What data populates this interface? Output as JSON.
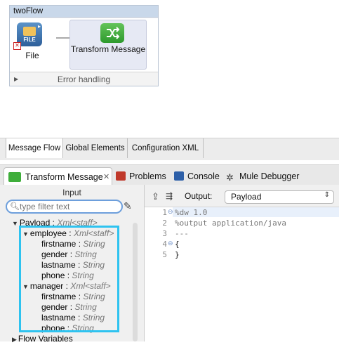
{
  "flow": {
    "title": "twoFlow",
    "file_label": "File",
    "file_icon_text": "FILE",
    "transform_label": "Transform Message",
    "error_handling": "Error handling"
  },
  "editor_tabs": [
    "Message Flow",
    "Global Elements",
    "Configuration XML"
  ],
  "view_tabs": {
    "active": "Transform Message",
    "others": [
      "Problems",
      "Console",
      "Mule Debugger"
    ]
  },
  "input": {
    "title": "Input",
    "filter_placeholder": "type filter text",
    "tree": {
      "payload": {
        "name": "Payload",
        "type": "Xml<staff>"
      },
      "employee": {
        "name": "employee",
        "type": "Xml<staff>",
        "fields": [
          {
            "name": "firstname",
            "type": "String"
          },
          {
            "name": "gender",
            "type": "String"
          },
          {
            "name": "lastname",
            "type": "String"
          },
          {
            "name": "phone",
            "type": "String"
          }
        ]
      },
      "manager": {
        "name": "manager",
        "type": "Xml<staff>",
        "fields": [
          {
            "name": "firstname",
            "type": "String"
          },
          {
            "name": "gender",
            "type": "String"
          },
          {
            "name": "lastname",
            "type": "String"
          },
          {
            "name": "phone",
            "type": "String"
          }
        ]
      },
      "flow_variables": "Flow Variables"
    }
  },
  "output": {
    "label": "Output:",
    "selected": "Payload",
    "lines": [
      {
        "n": "1",
        "text": "%dw 1.0"
      },
      {
        "n": "2",
        "text": "%output application/java"
      },
      {
        "n": "3",
        "text": "---"
      },
      {
        "n": "4",
        "text": "{"
      },
      {
        "n": "5",
        "text": "}"
      }
    ]
  },
  "colors": {
    "highlight": "#2ec3f0",
    "accent": "#6d9fdc"
  }
}
